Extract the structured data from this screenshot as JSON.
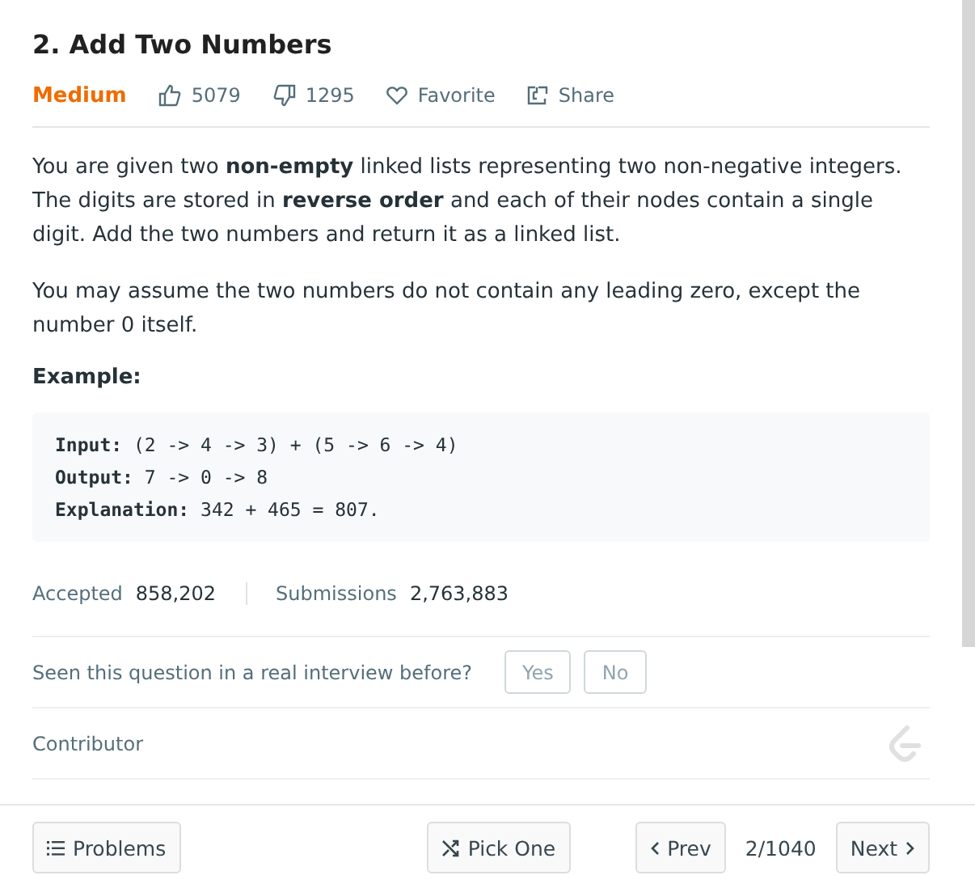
{
  "title": "2. Add Two Numbers",
  "meta": {
    "difficulty": "Medium",
    "likes": "5079",
    "dislikes": "1295",
    "favorite": "Favorite",
    "share": "Share"
  },
  "description": [
    "You are given two **non-empty** linked lists representing two non-negative integers. The digits are stored in **reverse order** and each of their nodes contain a single digit. Add the two numbers and return it as a linked list.",
    "You may assume the two numbers do not contain any leading zero, except the number 0 itself."
  ],
  "example_heading": "Example:",
  "example_lines": [
    "**Input:** (2 -> 4 -> 3) + (5 -> 6 -> 4)",
    "**Output:** 7 -> 0 -> 8",
    "**Explanation:** 342 + 465 = 807."
  ],
  "stats": {
    "accepted_label": "Accepted",
    "accepted": "858,202",
    "submissions_label": "Submissions",
    "submissions": "2,763,883"
  },
  "interview": {
    "question": "Seen this question in a real interview before?",
    "buttons": [
      "Yes",
      "No"
    ]
  },
  "contributor": "Contributor",
  "footer": {
    "problems": "Problems",
    "pick_one": "Pick One",
    "prev": "Prev",
    "position": "2/1040",
    "next": "Next"
  }
}
